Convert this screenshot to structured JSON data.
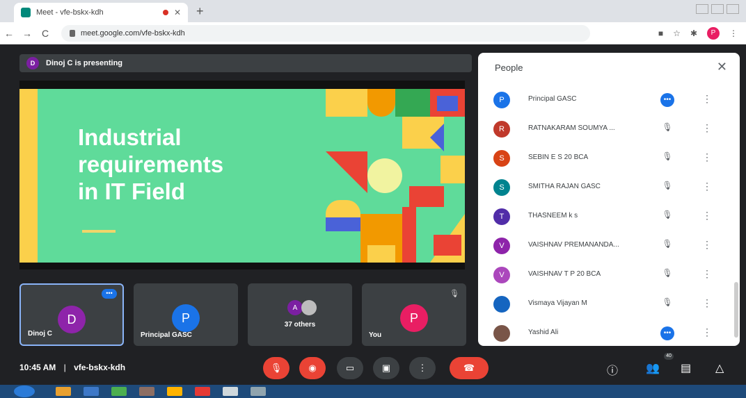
{
  "browser": {
    "tab_title": "Meet - vfe-bskx-kdh",
    "new_tab": "+",
    "url": "meet.google.com/vfe-bskx-kdh",
    "back": "←",
    "forward": "→",
    "reload": "C",
    "profile_initial": "P"
  },
  "banner": {
    "presenter_initial": "D",
    "text": "Dinoj C is presenting"
  },
  "slide": {
    "title": "Industrial\nrequirements\nin IT Field",
    "colors": {
      "background": "#5fdb9a",
      "title": "#ffffff",
      "accent": "#fbd04b"
    }
  },
  "tiles": [
    {
      "initial": "D",
      "name": "Dinoj C",
      "color": "#8e24aa",
      "badge": "•••"
    },
    {
      "initial": "P",
      "name": "Principal GASC",
      "color": "#1a73e8"
    },
    {
      "initial": "A",
      "name": "37 others",
      "color": "#7b1fa2"
    },
    {
      "initial": "P",
      "name": "You",
      "color": "#e91e63",
      "mic_icon": "mic-off-icon"
    }
  ],
  "bottom_bar": {
    "time": "10:45 AM",
    "separator": "|",
    "meeting_code": "vfe-bskx-kdh",
    "people_badge": "40",
    "colors": {
      "danger": "#ea4335",
      "neutral": "#3c4043"
    }
  },
  "people_panel": {
    "title": "People",
    "close": "✕",
    "people": [
      {
        "initial": "P",
        "name": "Principal GASC",
        "color": "#1a73e8",
        "status": "speaking"
      },
      {
        "initial": "R",
        "name": "RATNAKARAM SOUMYA ...",
        "color": "#c0392b",
        "status": "muted"
      },
      {
        "initial": "S",
        "name": "SEBIN E S 20 BCA",
        "color": "#d84315",
        "status": "muted"
      },
      {
        "initial": "S",
        "name": "SMITHA RAJAN GASC",
        "color": "#00838f",
        "status": "muted"
      },
      {
        "initial": "T",
        "name": "THASNEEM k s",
        "color": "#512da8",
        "status": "muted"
      },
      {
        "initial": "V",
        "name": "VAISHNAV PREMANANDA...",
        "color": "#8e24aa",
        "status": "muted"
      },
      {
        "initial": "V",
        "name": "VAISHNAV T P 20 BCA",
        "color": "#ab47bc",
        "status": "muted"
      },
      {
        "initial": "",
        "name": "Vismaya Vijayan M",
        "color": "#1565c0",
        "status": "muted"
      },
      {
        "initial": "",
        "name": "Yashid Ali",
        "color": "#795548",
        "status": "speaking"
      }
    ]
  }
}
